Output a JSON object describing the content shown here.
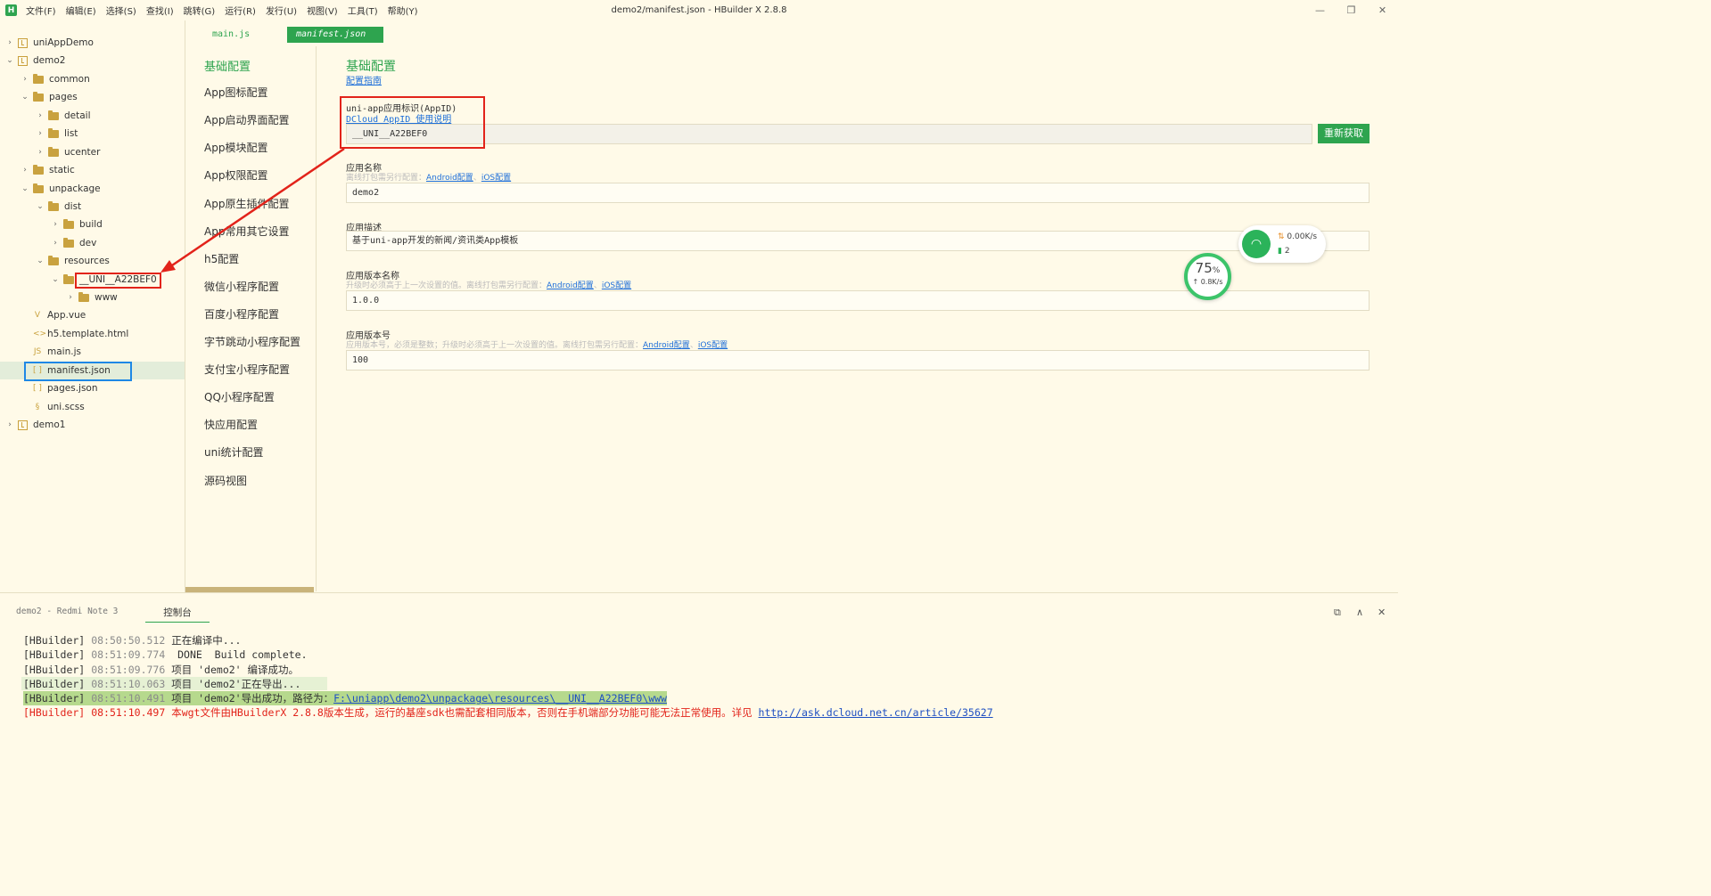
{
  "titlebar": {
    "menus": [
      "文件(F)",
      "编辑(E)",
      "选择(S)",
      "查找(I)",
      "跳转(G)",
      "运行(R)",
      "发行(U)",
      "视图(V)",
      "工具(T)",
      "帮助(Y)"
    ],
    "window_title": "demo2/manifest.json - HBuilder X 2.8.8",
    "logo": "H"
  },
  "sidebar": {
    "rows": [
      {
        "label": "uniAppDemo",
        "chevron": "›",
        "icon": "project-icon"
      },
      {
        "label": "demo2",
        "chevron": "⌄",
        "icon": "project-icon"
      },
      {
        "label": "common",
        "chevron": "›",
        "icon": "folder-icon"
      },
      {
        "label": "pages",
        "chevron": "⌄",
        "icon": "folder-icon"
      },
      {
        "label": "detail",
        "chevron": "›",
        "icon": "folder-icon"
      },
      {
        "label": "list",
        "chevron": "›",
        "icon": "folder-icon"
      },
      {
        "label": "ucenter",
        "chevron": "›",
        "icon": "folder-icon"
      },
      {
        "label": "static",
        "chevron": "›",
        "icon": "folder-icon"
      },
      {
        "label": "unpackage",
        "chevron": "⌄",
        "icon": "folder-icon"
      },
      {
        "label": "dist",
        "chevron": "⌄",
        "icon": "folder-icon"
      },
      {
        "label": "build",
        "chevron": "›",
        "icon": "folder-icon"
      },
      {
        "label": "dev",
        "chevron": "›",
        "icon": "folder-icon"
      },
      {
        "label": "resources",
        "chevron": "⌄",
        "icon": "folder-icon"
      },
      {
        "label": "__UNI__A22BEF0",
        "chevron": "⌄",
        "icon": "folder-icon"
      },
      {
        "label": "www",
        "chevron": "›",
        "icon": "folder-icon"
      },
      {
        "label": "App.vue",
        "chevron": "",
        "icon": "vue-file-icon",
        "glyph": "V"
      },
      {
        "label": "h5.template.html",
        "chevron": "",
        "icon": "html-file-icon",
        "glyph": "<>"
      },
      {
        "label": "main.js",
        "chevron": "",
        "icon": "js-file-icon",
        "glyph": "JS"
      },
      {
        "label": "manifest.json",
        "chevron": "",
        "icon": "json-file-icon",
        "glyph": "[ ]"
      },
      {
        "label": "pages.json",
        "chevron": "",
        "icon": "json-file-icon",
        "glyph": "[ ]"
      },
      {
        "label": "uni.scss",
        "chevron": "",
        "icon": "scss-file-icon",
        "glyph": "§"
      },
      {
        "label": "demo1",
        "chevron": "›",
        "icon": "project-icon"
      }
    ]
  },
  "tabs": [
    "main.js",
    "manifest.json"
  ],
  "config_nav": [
    "基础配置",
    "App图标配置",
    "App启动界面配置",
    "App模块配置",
    "App权限配置",
    "App原生插件配置",
    "App常用其它设置",
    "h5配置",
    "微信小程序配置",
    "百度小程序配置",
    "字节跳动小程序配置",
    "支付宝小程序配置",
    "QQ小程序配置",
    "快应用配置",
    "uni统计配置",
    "源码视图"
  ],
  "form": {
    "title": "基础配置",
    "guide_link": "配置指南",
    "appid_label": "uni-app应用标识(AppID)",
    "appid_help": "DCloud AppID 使用说明",
    "appid_value": "__UNI__A22BEF0",
    "refresh_button": "重新获取",
    "name_label": "应用名称",
    "name_hint": "离线打包需另行配置：",
    "name_value": "demo2",
    "desc_label": "应用描述",
    "desc_value": "基于uni-app开发的新闻/资讯类App模板",
    "vname_label": "应用版本名称",
    "vname_hint": "升级时必须高于上一次设置的值。离线打包需另行配置：",
    "vname_value": "1.0.0",
    "vcode_label": "应用版本号",
    "vcode_hint": "应用版本号，必须是整数；升级时必须高于上一次设置的值。离线打包需另行配置：",
    "vcode_value": "100",
    "android_link": "Android配置",
    "sep": "、",
    "ios_link": "iOS配置"
  },
  "network_widget": {
    "speed": "0.00K/s",
    "count": "2",
    "cpu": "75",
    "cpu_unit": "%",
    "cpu_speed": "↑ 0.8K/s"
  },
  "console": {
    "device_tab": "demo2 - Redmi Note 3",
    "console_tab": "控制台",
    "lines": [
      {
        "prefix": "[HBuilder]",
        "ts": "08:50:50.512",
        "text": " 正在编译中..."
      },
      {
        "prefix": "[HBuilder]",
        "ts": "08:51:09.774",
        "text": "  DONE  Build complete."
      },
      {
        "prefix": "[HBuilder]",
        "ts": "08:51:09.776",
        "text": " 项目 'demo2' 编译成功。"
      },
      {
        "prefix": "[HBuilder]",
        "ts": "08:51:10.063",
        "text": " 项目 'demo2'正在导出..."
      },
      {
        "prefix": "[HBuilder]",
        "ts": "08:51:10.491",
        "text": " 项目 'demo2'导出成功，路径为：",
        "link": "F:\\uniapp\\demo2\\unpackage\\resources\\__UNI__A22BEF0\\www"
      },
      {
        "prefix": "[HBuilder]",
        "ts": "08:51:10.497",
        "text": " 本wgt文件由HBuilderX 2.8.8版本生成，运行的基座sdk也需配套相同版本，否则在手机端部分功能可能无法正常使用。详见 ",
        "link": "http://ask.dcloud.net.cn/article/35627"
      }
    ]
  },
  "colors": {
    "accent": "#2ea44f",
    "annotation_red": "#e2231a",
    "annotation_blue": "#1e88e5",
    "highlight": "#b6d98d"
  }
}
